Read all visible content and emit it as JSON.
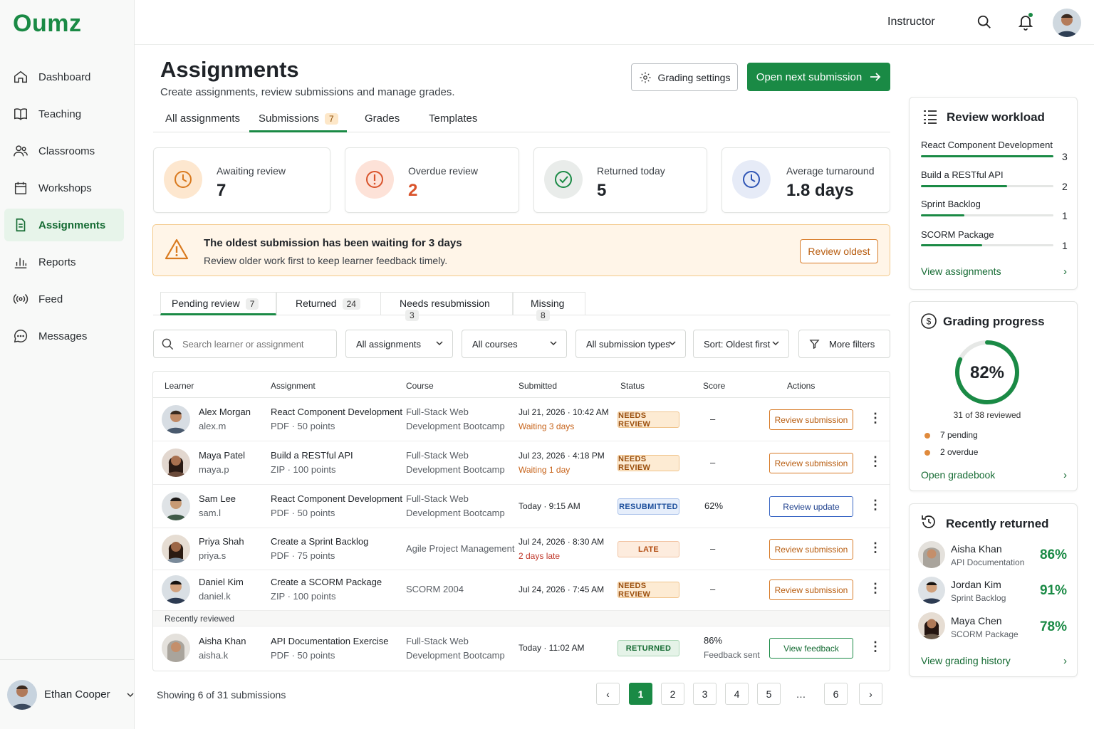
{
  "app": {
    "logo": "Oumz"
  },
  "nav": [
    {
      "label": "Dashboard",
      "icon": "home-icon"
    },
    {
      "label": "Teaching",
      "icon": "book-icon"
    },
    {
      "label": "Classrooms",
      "icon": "users-icon"
    },
    {
      "label": "Workshops",
      "icon": "calendar-icon"
    },
    {
      "label": "Assignments",
      "icon": "file-icon",
      "active": true
    },
    {
      "label": "Reports",
      "icon": "bar-chart-icon"
    },
    {
      "label": "Feed",
      "icon": "broadcast-icon"
    },
    {
      "label": "Messages",
      "icon": "chat-icon"
    }
  ],
  "user": {
    "name": "Ethan Cooper"
  },
  "topbar": {
    "role": "Instructor"
  },
  "header": {
    "title": "Assignments",
    "subtitle": "Create assignments, review submissions and manage grades.",
    "grading_settings": "Grading settings",
    "open_next": "Open next submission"
  },
  "tabs": {
    "all": "All assignments",
    "submissions": "Submissions",
    "submissions_count": "7",
    "grades": "Grades",
    "templates": "Templates"
  },
  "stats": [
    {
      "label": "Awaiting review",
      "value": "7",
      "color": "#d97a1f"
    },
    {
      "label": "Overdue review",
      "value": "2",
      "color": "#d9532b"
    },
    {
      "label": "Returned today",
      "value": "5",
      "color": "#1a8a45"
    },
    {
      "label": "Average turnaround",
      "value": "1.8 days",
      "color": "#2f55b5"
    }
  ],
  "alert": {
    "title": "The oldest submission has been waiting for 3 days",
    "body": "Review older work first to keep learner feedback timely.",
    "button": "Review oldest"
  },
  "subtabs": [
    {
      "label": "Pending review",
      "count": "7"
    },
    {
      "label": "Returned",
      "count": "24"
    },
    {
      "label": "Needs resubmission",
      "count": "3"
    },
    {
      "label": "Missing",
      "count": "8"
    }
  ],
  "filters": {
    "search_placeholder": "Search learner or assignment",
    "assignments": "All assignments",
    "courses": "All courses",
    "types": "All submission types",
    "sort": "Sort: Oldest first",
    "more": "More filters"
  },
  "table": {
    "headers": [
      "Learner",
      "Assignment",
      "Course",
      "Submitted",
      "Status",
      "Score",
      "Actions"
    ],
    "rows": [
      {
        "name": "Alex Morgan",
        "user": "alex.m",
        "assignment": "React Component Development",
        "meta": "PDF · 50 points",
        "course1": "Full-Stack Web",
        "course2": "Development Bootcamp",
        "submitted": "Jul 21, 2026 · 10:42 AM",
        "note": "Waiting 3 days",
        "status": "NEEDS REVIEW",
        "score": "–",
        "action": "Review submission"
      },
      {
        "name": "Maya Patel",
        "user": "maya.p",
        "assignment": "Build a RESTful API",
        "meta": "ZIP · 100 points",
        "course1": "Full-Stack Web",
        "course2": "Development Bootcamp",
        "submitted": "Jul 23, 2026 · 4:18 PM",
        "note": "Waiting 1 day",
        "status": "NEEDS REVIEW",
        "score": "–",
        "action": "Review submission"
      },
      {
        "name": "Sam Lee",
        "user": "sam.l",
        "assignment": "React Component Development",
        "meta": "PDF · 50 points",
        "course1": "Full-Stack Web",
        "course2": "Development Bootcamp",
        "submitted": "Today · 9:15 AM",
        "note": "",
        "status": "RESUBMITTED",
        "score": "62%",
        "action": "Review update"
      },
      {
        "name": "Priya Shah",
        "user": "priya.s",
        "assignment": "Create a Sprint Backlog",
        "meta": "PDF · 75 points",
        "course1": "Agile Project Management",
        "course2": "",
        "submitted": "Jul 24, 2026 · 8:30 AM",
        "note": "2 days late",
        "status": "LATE",
        "score": "–",
        "action": "Review submission"
      },
      {
        "name": "Daniel Kim",
        "user": "daniel.k",
        "assignment": "Create a SCORM Package",
        "meta": "ZIP · 100 points",
        "course1": "SCORM 2004",
        "course2": "",
        "submitted": "Jul 24, 2026 · 7:45 AM",
        "note": "",
        "status": "NEEDS REVIEW",
        "score": "–",
        "action": "Review submission"
      }
    ],
    "recent_label": "Recently reviewed",
    "recent": {
      "name": "Aisha Khan",
      "user": "aisha.k",
      "assignment": "API Documentation Exercise",
      "meta": "PDF · 50 points",
      "course1": "Full-Stack Web",
      "course2": "Development Bootcamp",
      "submitted": "Today · 11:02 AM",
      "status": "RETURNED",
      "score": "86%",
      "score_note": "Feedback sent",
      "action": "View feedback"
    }
  },
  "pagination": {
    "showing": "Showing 6 of 31 submissions",
    "pages": [
      "1",
      "2",
      "3",
      "4",
      "5",
      "…",
      "6"
    ],
    "prev": "‹",
    "next": "›"
  },
  "workload": {
    "title": "Review workload",
    "items": [
      {
        "name": "React Component Development",
        "count": "3",
        "fraction": 1.0
      },
      {
        "name": "Build a RESTful API",
        "count": "2",
        "fraction": 0.65
      },
      {
        "name": "Sprint Backlog",
        "count": "1",
        "fraction": 0.33
      },
      {
        "name": "SCORM Package",
        "count": "1",
        "fraction": 0.46
      }
    ],
    "link": "View assignments"
  },
  "progress": {
    "title": "Grading progress",
    "percent": "82%",
    "fraction": 0.82,
    "reviewed": "31 of 38 reviewed",
    "pending": "7 pending",
    "overdue": "2 overdue",
    "link": "Open gradebook"
  },
  "recent": {
    "title": "Recently returned",
    "items": [
      {
        "name": "Aisha Khan",
        "sub": "API Documentation",
        "score": "86%"
      },
      {
        "name": "Jordan Kim",
        "sub": "Sprint Backlog",
        "score": "91%"
      },
      {
        "name": "Maya Chen",
        "sub": "SCORM Package",
        "score": "78%"
      }
    ],
    "link": "View grading history"
  }
}
